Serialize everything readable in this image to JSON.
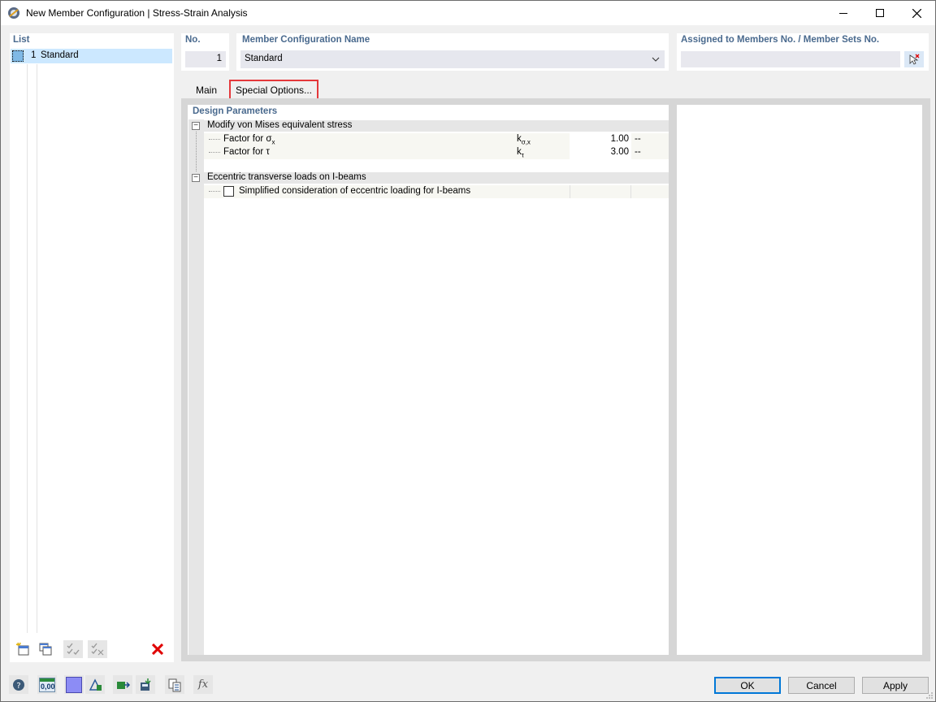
{
  "window": {
    "title": "New Member Configuration | Stress-Strain Analysis",
    "controls": {
      "minimize": "—",
      "maximize": "☐",
      "close": "✕"
    }
  },
  "list": {
    "header": "List",
    "items": [
      {
        "no": "1",
        "name": "Standard",
        "checked": true
      }
    ]
  },
  "number": {
    "label": "No.",
    "value": "1"
  },
  "config_name": {
    "label": "Member Configuration Name",
    "value": "Standard"
  },
  "assigned": {
    "label": "Assigned to Members No. / Member Sets No.",
    "value": ""
  },
  "tabs": [
    {
      "label": "Main",
      "active": false
    },
    {
      "label": "Special Options...",
      "active": true
    }
  ],
  "design_parameters": {
    "header": "Design Parameters",
    "groups": [
      {
        "title": "Modify von Mises equivalent stress",
        "rows": [
          {
            "label": "Factor for σ",
            "label_sub": "x",
            "symbol": "k",
            "symbol_sub": "σ,x",
            "value": "1.00",
            "unit": "--"
          },
          {
            "label": "Factor for τ",
            "label_sub": "",
            "symbol": "k",
            "symbol_sub": "τ",
            "value": "3.00",
            "unit": "--"
          }
        ]
      },
      {
        "title": "Eccentric transverse loads on I-beams",
        "rows": [
          {
            "label": "Simplified consideration of eccentric loading for I-beams",
            "checkbox": true,
            "checked": false
          }
        ]
      }
    ]
  },
  "buttons": {
    "ok": "OK",
    "cancel": "Cancel",
    "apply": "Apply"
  },
  "bottom_value_icon": "0,00",
  "colors": {
    "accent_blue": "#4a6a8e",
    "selection": "#cce8ff",
    "tab_highlight": "#e4383b",
    "delete_red": "#e00000"
  }
}
